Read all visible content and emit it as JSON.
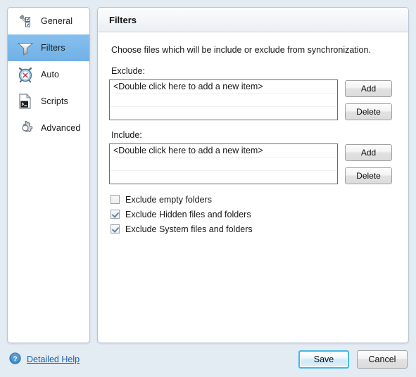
{
  "sidebar": {
    "items": [
      {
        "label": "General",
        "icon": "wrench-checklist-icon",
        "selected": false
      },
      {
        "label": "Filters",
        "icon": "funnel-icon",
        "selected": true
      },
      {
        "label": "Auto",
        "icon": "alarm-clock-icon",
        "selected": false
      },
      {
        "label": "Scripts",
        "icon": "script-console-icon",
        "selected": false
      },
      {
        "label": "Advanced",
        "icon": "gear-icon",
        "selected": false
      }
    ]
  },
  "panel": {
    "title": "Filters",
    "description": "Choose files which will be include or exclude from synchronization.",
    "exclude": {
      "label": "Exclude:",
      "rows": [
        "<Double click here to add a new item>",
        "",
        ""
      ],
      "add_label": "Add",
      "delete_label": "Delete"
    },
    "include": {
      "label": "Include:",
      "rows": [
        "<Double click here to add a new item>",
        "",
        ""
      ],
      "add_label": "Add",
      "delete_label": "Delete"
    },
    "checkboxes": [
      {
        "label": "Exclude empty folders",
        "checked": false
      },
      {
        "label": "Exclude Hidden files and folders",
        "checked": true
      },
      {
        "label": "Exclude System files and folders",
        "checked": true
      }
    ]
  },
  "footer": {
    "help_icon": "help-circle-icon",
    "help_label": "Detailed Help",
    "save_label": "Save",
    "cancel_label": "Cancel"
  },
  "colors": {
    "selection_blue": "#7cb9ec",
    "link_blue": "#1c5fa8",
    "default_button_border": "#43b6e8",
    "window_background": "#e3ebf3"
  }
}
